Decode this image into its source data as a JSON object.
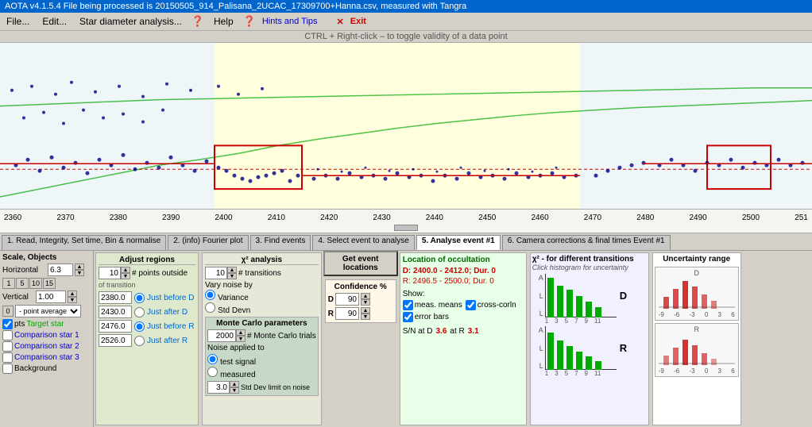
{
  "titlebar": {
    "text": "AOTA v4.1.5.4   File being processed is  20150505_914_Palisana_2UCAC_17309700+Hanna.csv,  measured with Tangra"
  },
  "menubar": {
    "file": "File...",
    "edit": "Edit...",
    "star_diameter": "Star diameter analysis...",
    "help_icon": "?",
    "help": "Help",
    "hints_icon": "?",
    "hints": "Hints and Tips",
    "exit_x": "✕",
    "exit": "Exit"
  },
  "hintbar": {
    "text": "CTRL + Right-click   –   to toggle validity of a data point"
  },
  "tabs": [
    {
      "id": "tab1",
      "label": "1. Read, Integrity, Set time, Bin & normalise"
    },
    {
      "id": "tab2",
      "label": "2. (info)  Fourier plot"
    },
    {
      "id": "tab3",
      "label": "3. Find events"
    },
    {
      "id": "tab4",
      "label": "4. Select event to analyse"
    },
    {
      "id": "tab5",
      "label": "5. Analyse event #1",
      "active": true
    },
    {
      "id": "tab6",
      "label": "6. Camera corrections & final times Event #1"
    }
  ],
  "scale": {
    "label": "Scale,  Objects",
    "horizontal_label": "Horizontal",
    "horizontal_value": "6.3",
    "buttons": [
      "1",
      "5",
      "10",
      "15"
    ],
    "vertical_label": "Vertical",
    "vertical_value": "1.00",
    "zero_label": "0",
    "point_average": "- point average"
  },
  "objects": {
    "pts_checked": true,
    "pts_label": "pts",
    "target_star": "Target star",
    "comp1": "Comparison star 1",
    "comp2": "Comparison star 2",
    "comp3": "Comparison star 3",
    "background": "Background"
  },
  "adjust_regions": {
    "title": "Adjust regions",
    "points_outside": "# points outside",
    "points_value": "10",
    "of_transition": "of transition",
    "just_before_d_value": "2380.0",
    "just_after_d_value": "2430.0",
    "just_before_r_value": "2476.0",
    "just_after_r_value": "2526.0",
    "just_before_d_label": "Just before D",
    "just_after_d_label": "Just after D",
    "just_before_r_label": "Just before R",
    "just_after_r_label": "Just after R"
  },
  "chi2": {
    "title": "χ² analysis",
    "transitions_label": "# transitions",
    "transitions_value": "10",
    "vary_noise_label": "Vary noise by",
    "variance_label": "Variance",
    "std_devn_label": "Std Devn",
    "monte_carlo_title": "Monte Carlo parameters",
    "trials_label": "# Monte Carlo trials",
    "trials_value": "2000",
    "noise_applied": "Noise applied to",
    "test_signal_label": "test signal",
    "measured_label": "measured",
    "std_dev_label": "Std Dev limit on noise",
    "std_dev_value": "3.0"
  },
  "confidence": {
    "title": "Confidence %",
    "d_label": "D",
    "d_value": "90",
    "r_label": "R",
    "r_value": "90",
    "get_event_btn": "Get event\nlocations"
  },
  "location": {
    "title": "Location of occultation",
    "d_text": "D: 2400.0 - 2412.0; Dur. 0",
    "r_text": "R: 2496.5 - 2500.0; Dur. 0",
    "show_label": "Show:",
    "meas_means": "meas. means",
    "cross_corln": "cross-corln",
    "error_bars": "error bars"
  },
  "snr": {
    "label_d": "S/N  at D",
    "value_d": "3.6",
    "label_r": "at R",
    "value_r": "3.1"
  },
  "chi2_hist": {
    "title": "χ² - for different transitions",
    "subtitle": "Click histogram for uncertainty",
    "d_label": "D",
    "r_label": "R",
    "d_axis": [
      "A",
      "L",
      "L"
    ],
    "r_axis": [
      "A",
      "L",
      "L"
    ],
    "x_ticks_d": [
      "1",
      "3",
      "5",
      "7",
      "9",
      "11"
    ],
    "x_ticks_r": [
      "1",
      "3",
      "5",
      "7",
      "9",
      "11"
    ]
  },
  "uncertainty": {
    "title": "Uncertainty range",
    "d_axis": [
      "-9",
      "-6",
      "-3",
      "0",
      "3",
      "6"
    ],
    "r_axis": [
      "-9",
      "-6",
      "-3",
      "0",
      "3",
      "6"
    ]
  },
  "axis_ticks": [
    "2360",
    "2370",
    "2380",
    "2390",
    "2400",
    "2410",
    "2420",
    "2430",
    "2440",
    "2450",
    "2460",
    "2470",
    "2480",
    "2490",
    "2500",
    "251"
  ]
}
